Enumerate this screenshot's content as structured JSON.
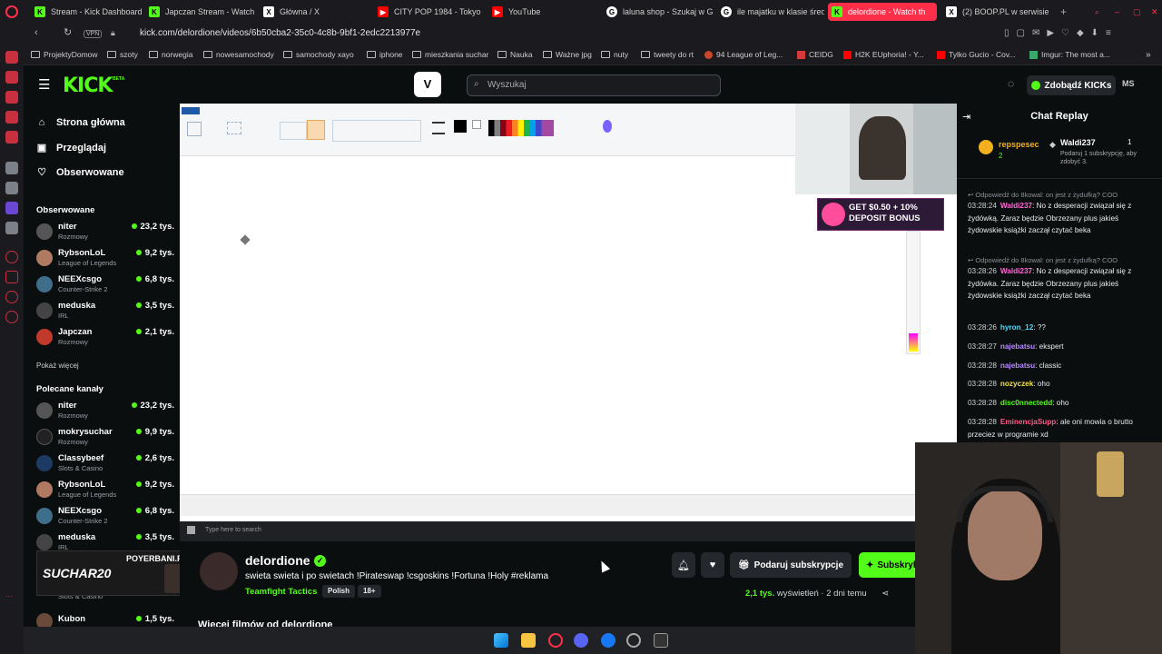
{
  "browser": {
    "tabs": [
      {
        "title": "Stream - Kick Dashboard",
        "icon": "kick-icon"
      },
      {
        "title": "Japczan Stream - Watch",
        "icon": "kick-icon"
      },
      {
        "title": "Główna / X",
        "icon": "x-icon"
      },
      {
        "title": "CITY POP 1984 - Tokyo",
        "icon": "youtube-icon"
      },
      {
        "title": "YouTube",
        "icon": "youtube-icon"
      },
      {
        "title": "laluna shop - Szukaj w G",
        "icon": "google-icon"
      },
      {
        "title": "ile majatku w klasie śred",
        "icon": "google-icon"
      },
      {
        "title": "delordione - Watch th",
        "icon": "kick-icon",
        "active": true
      },
      {
        "title": "(2) BOOP.PL w serwisie",
        "icon": "x-icon"
      }
    ],
    "vpn_label": "VPN",
    "url": "kick.com/delordione/videos/6b50cba2-35c0-4c8b-9bf1-2edc2213977e",
    "bookmarks": [
      "ProjektyDomow",
      "szoty",
      "norwegia",
      "nowesamochody",
      "samochody xayo",
      "iphone",
      "mieszkania suchar",
      "Nauka",
      "Ważne jpg",
      "nuty",
      "tweety do rt",
      "94 League of Leg...",
      "CEIDG",
      "H2K EUphoria! - Y...",
      "Tylko Gucio - Cov...",
      "Imgur: The most a..."
    ]
  },
  "kick": {
    "logo": "KICK",
    "logo_badge": "BETA",
    "search_placeholder": "Wyszukaj",
    "cta": "Zdobądź KICKs",
    "user_initials": "MS",
    "nav": [
      {
        "label": "Strona główna",
        "icon": "home-icon"
      },
      {
        "label": "Przeglądaj",
        "icon": "browse-icon"
      },
      {
        "label": "Obserwowane",
        "icon": "heart-icon"
      }
    ],
    "followed_title": "Obserwowane",
    "followed": [
      {
        "name": "niter",
        "category": "Rozmowy",
        "viewers": "23,2 tys."
      },
      {
        "name": "RybsonLoL",
        "category": "League of Legends",
        "viewers": "9,2 tys."
      },
      {
        "name": "NEEXcsgo",
        "category": "Counter-Strike 2",
        "viewers": "6,8 tys."
      },
      {
        "name": "meduska",
        "category": "IRL",
        "viewers": "3,5 tys."
      },
      {
        "name": "Japczan",
        "category": "Rozmowy",
        "viewers": "2,1 tys."
      }
    ],
    "show_more": "Pokaż więcej",
    "recommended_title": "Polecane kanały",
    "recommended": [
      {
        "name": "niter",
        "category": "Rozmowy",
        "viewers": "23,2 tys."
      },
      {
        "name": "mokrysuchar",
        "category": "Rozmowy",
        "viewers": "9,9 tys."
      },
      {
        "name": "Classybeef",
        "category": "Slots & Casino",
        "viewers": "2,6 tys."
      },
      {
        "name": "RybsonLoL",
        "category": "League of Legends",
        "viewers": "9,2 tys."
      },
      {
        "name": "NEEXcsgo",
        "category": "Counter-Strike 2",
        "viewers": "6,8 tys."
      },
      {
        "name": "meduska",
        "category": "IRL",
        "viewers": "3,5 tys."
      },
      {
        "name": "",
        "category": "Slots & Casino",
        "viewers": ""
      },
      {
        "name": "Kubon",
        "category": "",
        "viewers": "1,5 tys."
      }
    ]
  },
  "video": {
    "promo_text": "GET $0.50 + 10% DEPOSIT BONUS",
    "taskbar_search": "Type here to search",
    "ad_banner": {
      "code": "SUCHAR20",
      "brand": "POYERBANI.PL"
    }
  },
  "chat": {
    "title": "Chat Replay",
    "top": {
      "name1": "repspesec",
      "count1": "2",
      "name2": "Waldi237",
      "count2": "1",
      "prompt": "Podaruj 1 subskrypcję, aby zdobyć 3."
    },
    "messages": [
      {
        "reply": "Odpowiedź do 8kowal: on jest z żydufką? COO",
        "time": "03:28:24",
        "user": "Waldi237",
        "user_color": "#ff6bd5",
        "text": "No z desperacji związał się z żydówką. Zaraz będzie Obrzezany plus jakieś żydowskie książki zaczął czytać beka"
      },
      {
        "reply": "Odpowiedź do 8kowal: on jest z żydufką? COO",
        "time": "03:28:26",
        "user": "Waldi237",
        "user_color": "#ff6bd5",
        "text": "No z desperacji związał się z żydówka. Zaraz będzie Obrzezany plus jakieś żydowskie książki zaczął czytać beka"
      },
      {
        "time": "03:28:26",
        "user": "hyron_12",
        "user_color": "#53d8fb",
        "text": "??"
      },
      {
        "time": "03:28:27",
        "user": "najebatsu",
        "user_color": "#b78cff",
        "text": "ekspert"
      },
      {
        "time": "03:28:28",
        "user": "najebatsu",
        "user_color": "#b78cff",
        "text": "classic"
      },
      {
        "time": "03:28:28",
        "user": "nozyczek",
        "user_color": "#f2e14c",
        "text": "oho"
      },
      {
        "time": "03:28:28",
        "user": "disc0nnectedd",
        "user_color": "#53fc18",
        "text": "oho"
      },
      {
        "time": "03:28:28",
        "user": "EminencjaSupp",
        "user_color": "#ff5a8a",
        "text": "ale oni mowia o brutto przeciez w programie xd"
      }
    ]
  },
  "stream": {
    "channel": "delordione",
    "title": "swieta swieta i po swietach !Pirateswap !csgoskins !Fortuna !Holy #reklama",
    "category": "Teamfight Tactics",
    "tags": [
      "Polish",
      "18+"
    ],
    "gift_sub": "Podaruj subskrypcje",
    "subscribe": "Subskrybuj",
    "views_count": "2,1 tys.",
    "views_label": "wyświetleń",
    "age": "2 dni temu",
    "more_videos": "Więcej filmów od delordione"
  },
  "colors": {
    "kick_green": "#53fc18",
    "opera_red": "#ff2f4a",
    "bg": "#0b0e0f"
  }
}
